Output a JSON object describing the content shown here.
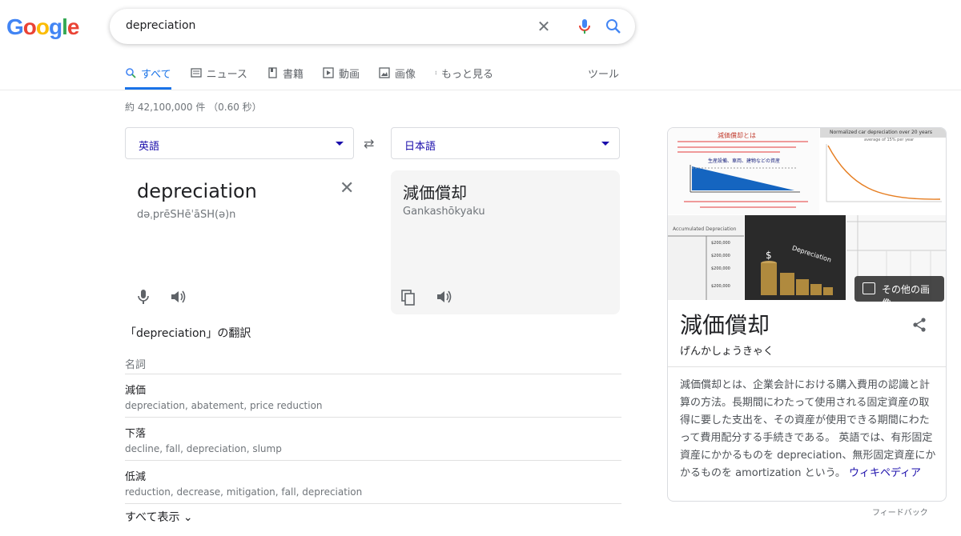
{
  "logo": {
    "letters": [
      "G",
      "o",
      "o",
      "g",
      "l",
      "e"
    ],
    "colors": [
      "#4285F4",
      "#EA4335",
      "#FBBC05",
      "#4285F4",
      "#34A853",
      "#EA4335"
    ]
  },
  "search": {
    "query": "depreciation"
  },
  "tabs": [
    {
      "label": "すべて",
      "icon": "search-icon",
      "active": true
    },
    {
      "label": "ニュース",
      "icon": "news-icon"
    },
    {
      "label": "書籍",
      "icon": "book-icon"
    },
    {
      "label": "動画",
      "icon": "video-icon"
    },
    {
      "label": "画像",
      "icon": "image-icon"
    },
    {
      "label": "もっと見る",
      "icon": "more-vert-icon"
    }
  ],
  "tools_label": "ツール",
  "stats": "約 42,100,000 件 （0.60 秒）",
  "translate": {
    "source_lang": "英語",
    "target_lang": "日本語",
    "source_word": "depreciation",
    "phonetic": "dəˌprēSHēˈāSH(ə)n",
    "target_word": "減価償却",
    "romanization": "Gankashōkyaku",
    "translations_title": "「depreciation」の翻訳",
    "part_of_speech": "名詞",
    "rows": [
      {
        "term": "減価",
        "synonyms": "depreciation, abatement, price reduction"
      },
      {
        "term": "下落",
        "synonyms": "decline, fall, depreciation, slump"
      },
      {
        "term": "低減",
        "synonyms": "reduction, decrease, mitigation, fall, depreciation"
      }
    ],
    "show_all": "すべて表示"
  },
  "panel": {
    "img1_title": "減価償却とは",
    "img1_caption1": "生産設備、車両、建物などの資産",
    "img2_title": "Normalized car depreciation over 20 years",
    "img2_sub": "average of 15% per year",
    "img4_label": "Depreciation",
    "img3_header": "Accumulated Depreciation",
    "img3_vals": [
      "$200,000",
      "$200,000",
      "$200,000",
      "$200,000"
    ],
    "more_images": "その他の画像",
    "title": "減価償却",
    "reading": "げんかしょうきゃく",
    "description": "減価償却とは、企業会計における購入費用の認識と計算の方法。長期間にわたって使用される固定資産の取得に要した支出を、その資産が使用できる期間にわたって費用配分する手続きである。 英語では、有形固定資産にかかるものを depreciation、無形固定資産にかかるものを amortization という。",
    "source_link": "ウィキペディア"
  },
  "feedback": "フィードバック"
}
